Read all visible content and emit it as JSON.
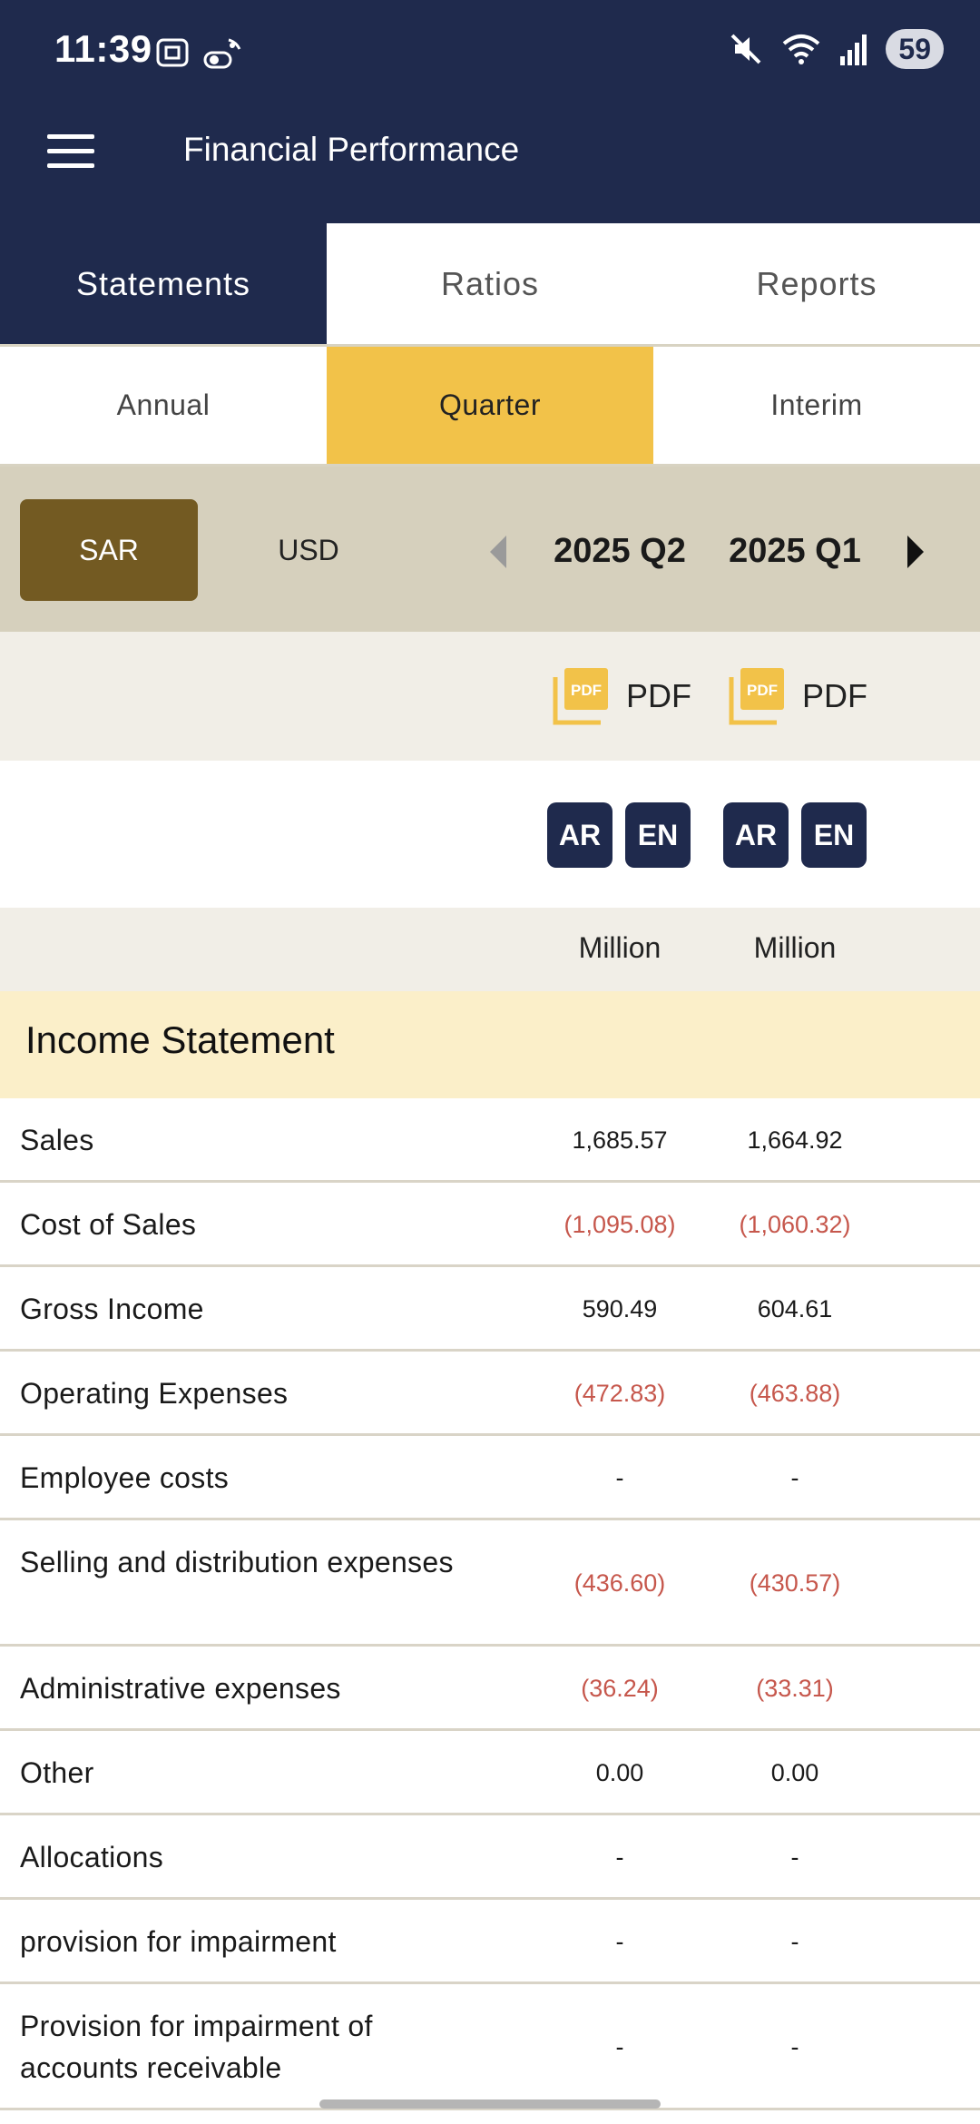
{
  "status_bar": {
    "time": "11:39",
    "battery": "59",
    "icons": [
      "screenshot-icon",
      "toggle-icon",
      "mute-icon",
      "wifi-icon",
      "signal-icon"
    ]
  },
  "app_bar": {
    "title": "Financial Performance",
    "menu_icon": "hamburger-menu-icon"
  },
  "main_tabs": [
    {
      "label": "Statements",
      "active": true
    },
    {
      "label": "Ratios",
      "active": false
    },
    {
      "label": "Reports",
      "active": false
    }
  ],
  "sub_tabs": [
    {
      "label": "Annual",
      "active": false
    },
    {
      "label": "Quarter",
      "active": true
    },
    {
      "label": "Interim",
      "active": false
    }
  ],
  "currency": {
    "options": [
      "SAR",
      "USD"
    ],
    "selected": "SAR"
  },
  "periods": [
    "2025 Q2",
    "2025 Q1"
  ],
  "pdf_label": "PDF",
  "languages": [
    "AR",
    "EN"
  ],
  "unit": "Million",
  "section": {
    "title": "Income Statement"
  },
  "rows": [
    {
      "label": "Sales",
      "q2": "1,685.57",
      "q1": "1,664.92",
      "negative": false,
      "tall": false
    },
    {
      "label": "Cost of Sales",
      "q2": "(1,095.08)",
      "q1": "(1,060.32)",
      "negative": true,
      "tall": false
    },
    {
      "label": "Gross Income",
      "q2": "590.49",
      "q1": "604.61",
      "negative": false,
      "tall": false
    },
    {
      "label": "Operating Expenses",
      "q2": "(472.83)",
      "q1": "(463.88)",
      "negative": true,
      "tall": false
    },
    {
      "label": "Employee costs",
      "q2": "-",
      "q1": "-",
      "negative": false,
      "tall": false
    },
    {
      "label": "Selling and distribution expenses",
      "q2": "(436.60)",
      "q1": "(430.57)",
      "negative": true,
      "tall": true
    },
    {
      "label": "Administrative expenses",
      "q2": "(36.24)",
      "q1": "(33.31)",
      "negative": true,
      "tall": false
    },
    {
      "label": "Other",
      "q2": "0.00",
      "q1": "0.00",
      "negative": false,
      "tall": false
    },
    {
      "label": "Allocations",
      "q2": "-",
      "q1": "-",
      "negative": false,
      "tall": false
    },
    {
      "label": "provision for impairment",
      "q2": "-",
      "q1": "-",
      "negative": false,
      "tall": false
    },
    {
      "label": "Provision for impairment of accounts receivable",
      "q2": "-",
      "q1": "-",
      "negative": false,
      "tall": true
    }
  ],
  "colors": {
    "navy": "#1f2a4d",
    "gold": "#f2c249",
    "brown": "#735a22",
    "negative": "#c6574c",
    "section_bg": "#fbefc9"
  }
}
